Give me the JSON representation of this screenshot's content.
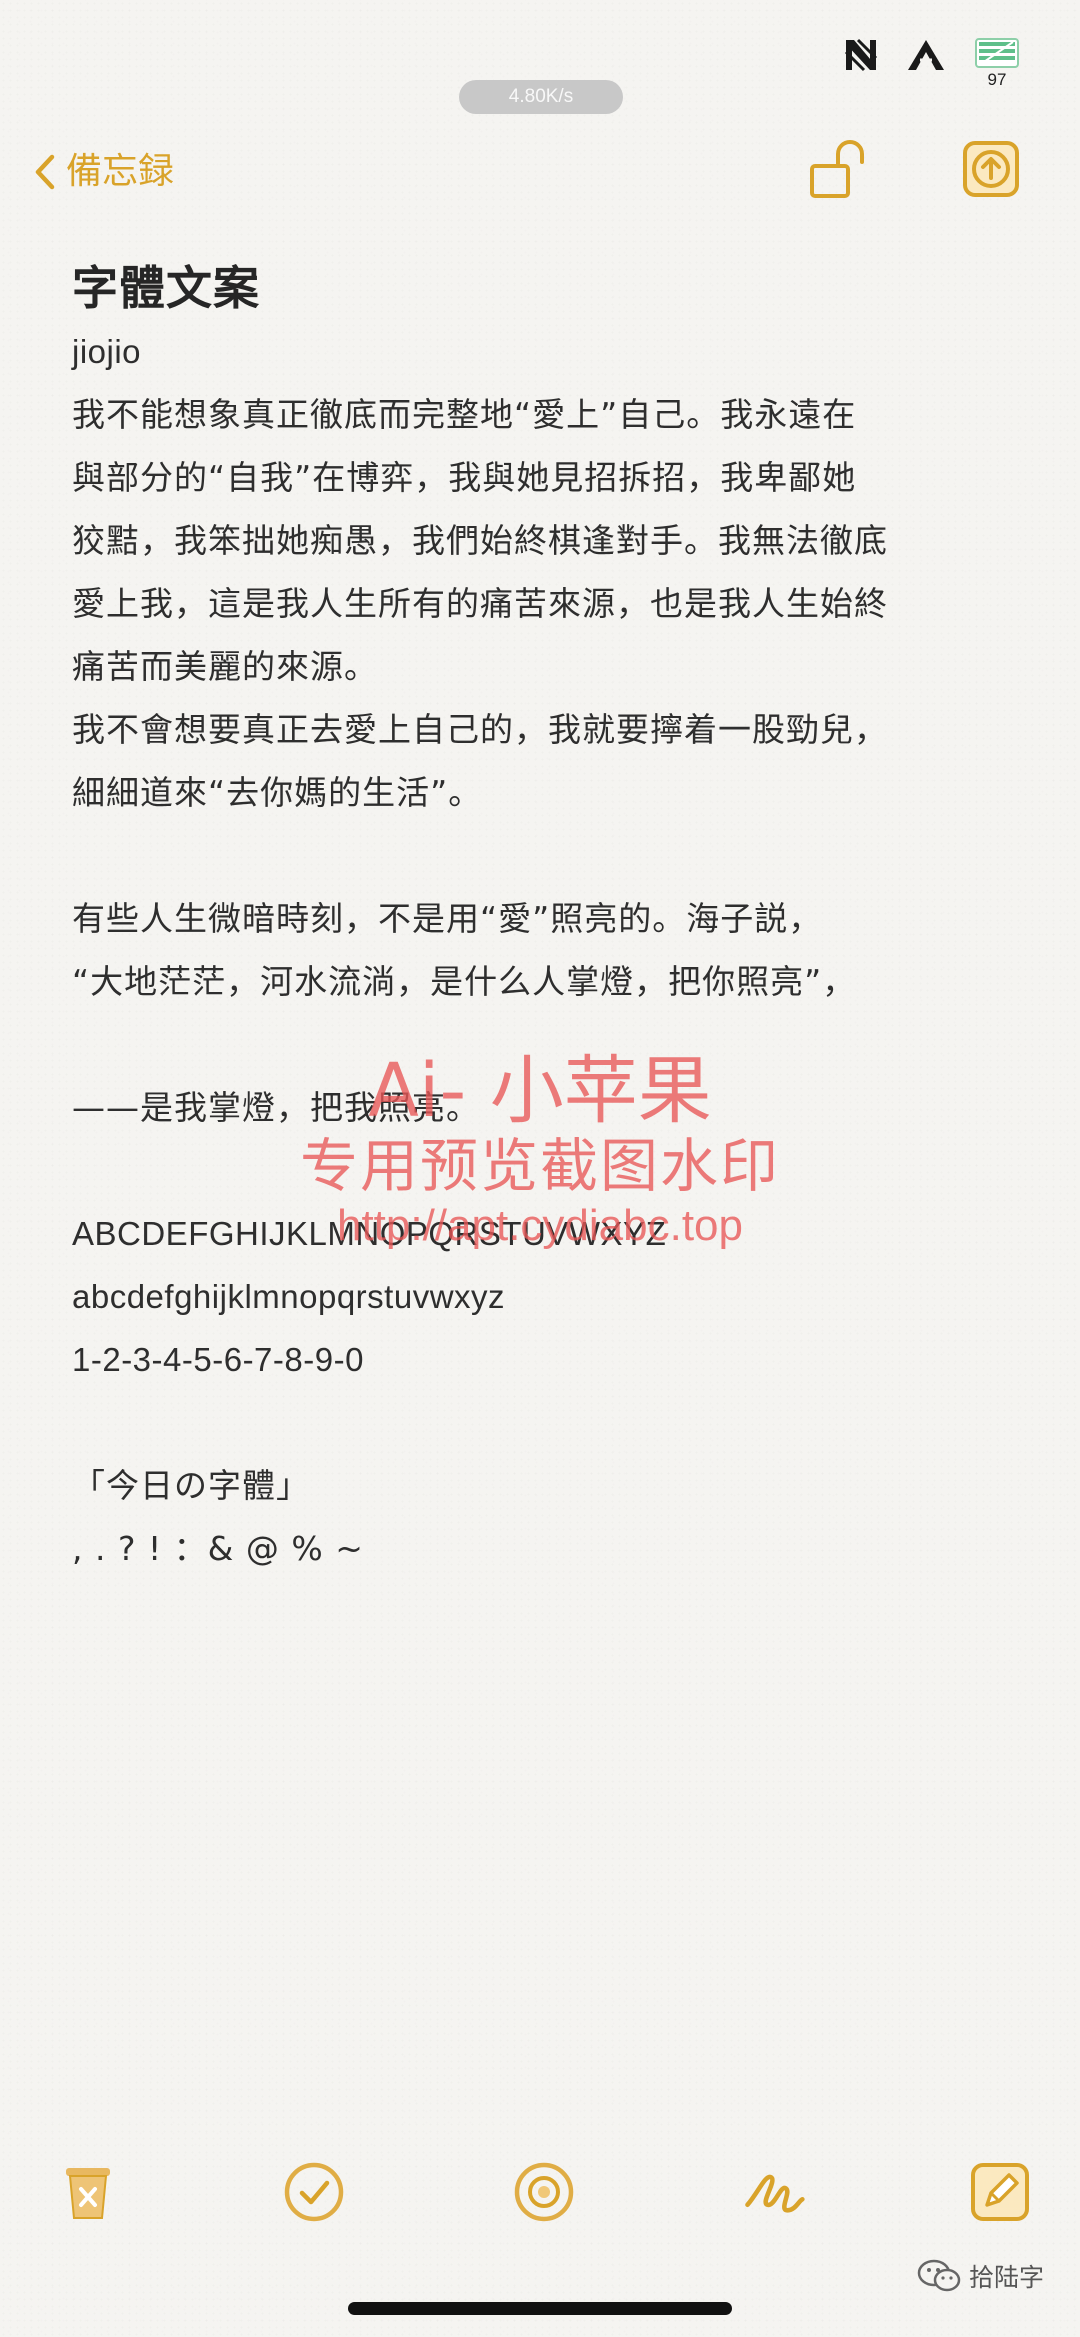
{
  "status_bar": {
    "net_speed": "4.80K/s",
    "battery_level": "97"
  },
  "nav": {
    "back_label": "備忘録"
  },
  "note": {
    "title": "字體文案",
    "lines": [
      "jiojio",
      "我不能想象真正徹底而完整地“愛上”自己。我永遠在",
      "與部分的“自我”在博弈，我與她見招拆招，我卑鄙她",
      "狡黠，我笨拙她痴愚，我們始終棋逢對手。我無法徹底",
      "愛上我，這是我人生所有的痛苦來源，也是我人生始終",
      "痛苦而美麗的來源。",
      "我不會想要真正去愛上自己的，我就要擰着一股勁兒，",
      "細細道來“去你媽的生活”。",
      "",
      "有些人生微暗時刻，不是用“愛”照亮的。海子説，",
      "“大地茫茫，河水流淌，是什么人掌燈，把你照亮”，",
      "",
      "——是我掌燈，把我照亮。",
      "",
      "ABCDEFGHIJKLMNOPQRSTUVWXYZ",
      "abcdefghijklmnopqrstuvwxyz",
      "1-2-3-4-5-6-7-8-9-0",
      "",
      "「今日の字體」",
      ", . ? ! ：&  @  %  ~"
    ]
  },
  "watermark": {
    "title": "Ai- 小苹果",
    "subtitle": "专用预览截图水印",
    "url": "http://apt.cydiabc.top"
  },
  "toolbar": {
    "delete_icon": "trash-icon",
    "checklist_icon": "checklist-icon",
    "camera_icon": "camera-icon",
    "sketch_icon": "sketch-icon",
    "compose_icon": "compose-icon"
  },
  "source": {
    "label": "拾陆字"
  },
  "colors": {
    "accent": "#d9a32a",
    "background": "#f5f4f1",
    "watermark": "#e85656"
  }
}
